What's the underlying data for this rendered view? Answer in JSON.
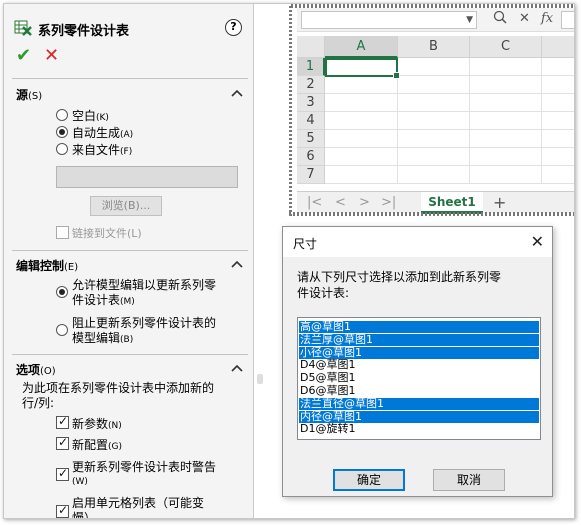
{
  "pm": {
    "title": "系列零件设计表",
    "help": "?",
    "ok": "✔",
    "cancel": "✕",
    "source": {
      "heading": "源",
      "heading_key": "(S)",
      "options": [
        {
          "label": "空白",
          "key": "(K)",
          "selected": false
        },
        {
          "label": "自动生成",
          "key": "(A)",
          "selected": true
        },
        {
          "label": "来自文件",
          "key": "(F)",
          "selected": false
        }
      ],
      "file_value": "",
      "browse": "浏览(B)...",
      "link": "链接到文件(L)"
    },
    "edit": {
      "heading": "编辑控制",
      "heading_key": "(E)",
      "opt1_line1": "允许模型编辑以更新系列零",
      "opt1_line2": "件设计表",
      "opt1_key": "(M)",
      "opt2_line1": "阻止更新系列零件设计表的",
      "opt2_line2": "模型编辑",
      "opt2_key": "(B)"
    },
    "options": {
      "heading": "选项",
      "heading_key": "(O)",
      "desc_line1": "为此项在系列零件设计表中添加新的",
      "desc_line2": "行/列:",
      "cb1": "新参数",
      "cb1_key": "(N)",
      "cb2": "新配置",
      "cb2_key": "(G)",
      "cb3_line1": "更新系列零件设计表时警告",
      "cb3_key": "(W)",
      "cb4_line1": "启用单元格列表（可能变",
      "cb4_line2": "慢）"
    }
  },
  "sheet": {
    "fx": "fx",
    "columns": [
      "A",
      "B",
      "C"
    ],
    "rows": [
      "1",
      "2",
      "3",
      "4",
      "5",
      "6",
      "7"
    ],
    "active_cell": "A1",
    "tab": "Sheet1",
    "add_tab": "+"
  },
  "dialog": {
    "title": "尺寸",
    "close": "✕",
    "prompt_line1": "请从下列尺寸选择以添加到此新系列零",
    "prompt_line2": "件设计表:",
    "items": [
      {
        "label": "高@草图1",
        "selected": true
      },
      {
        "label": "法兰厚@草图1",
        "selected": true
      },
      {
        "label": "小径@草图1",
        "selected": true
      },
      {
        "label": "D4@草图1",
        "selected": false
      },
      {
        "label": "D5@草图1",
        "selected": false
      },
      {
        "label": "D6@草图1",
        "selected": false
      },
      {
        "label": "法兰直径@草图1",
        "selected": true
      },
      {
        "label": "内径@草图1",
        "selected": true
      },
      {
        "label": "D1@旋转1",
        "selected": false
      }
    ],
    "ok": "确定",
    "cancel": "取消"
  },
  "colors": {
    "excel_green": "#217346",
    "selection_blue": "#0078d7",
    "ok_green": "#2f9a2f",
    "cancel_red": "#dd2222"
  }
}
